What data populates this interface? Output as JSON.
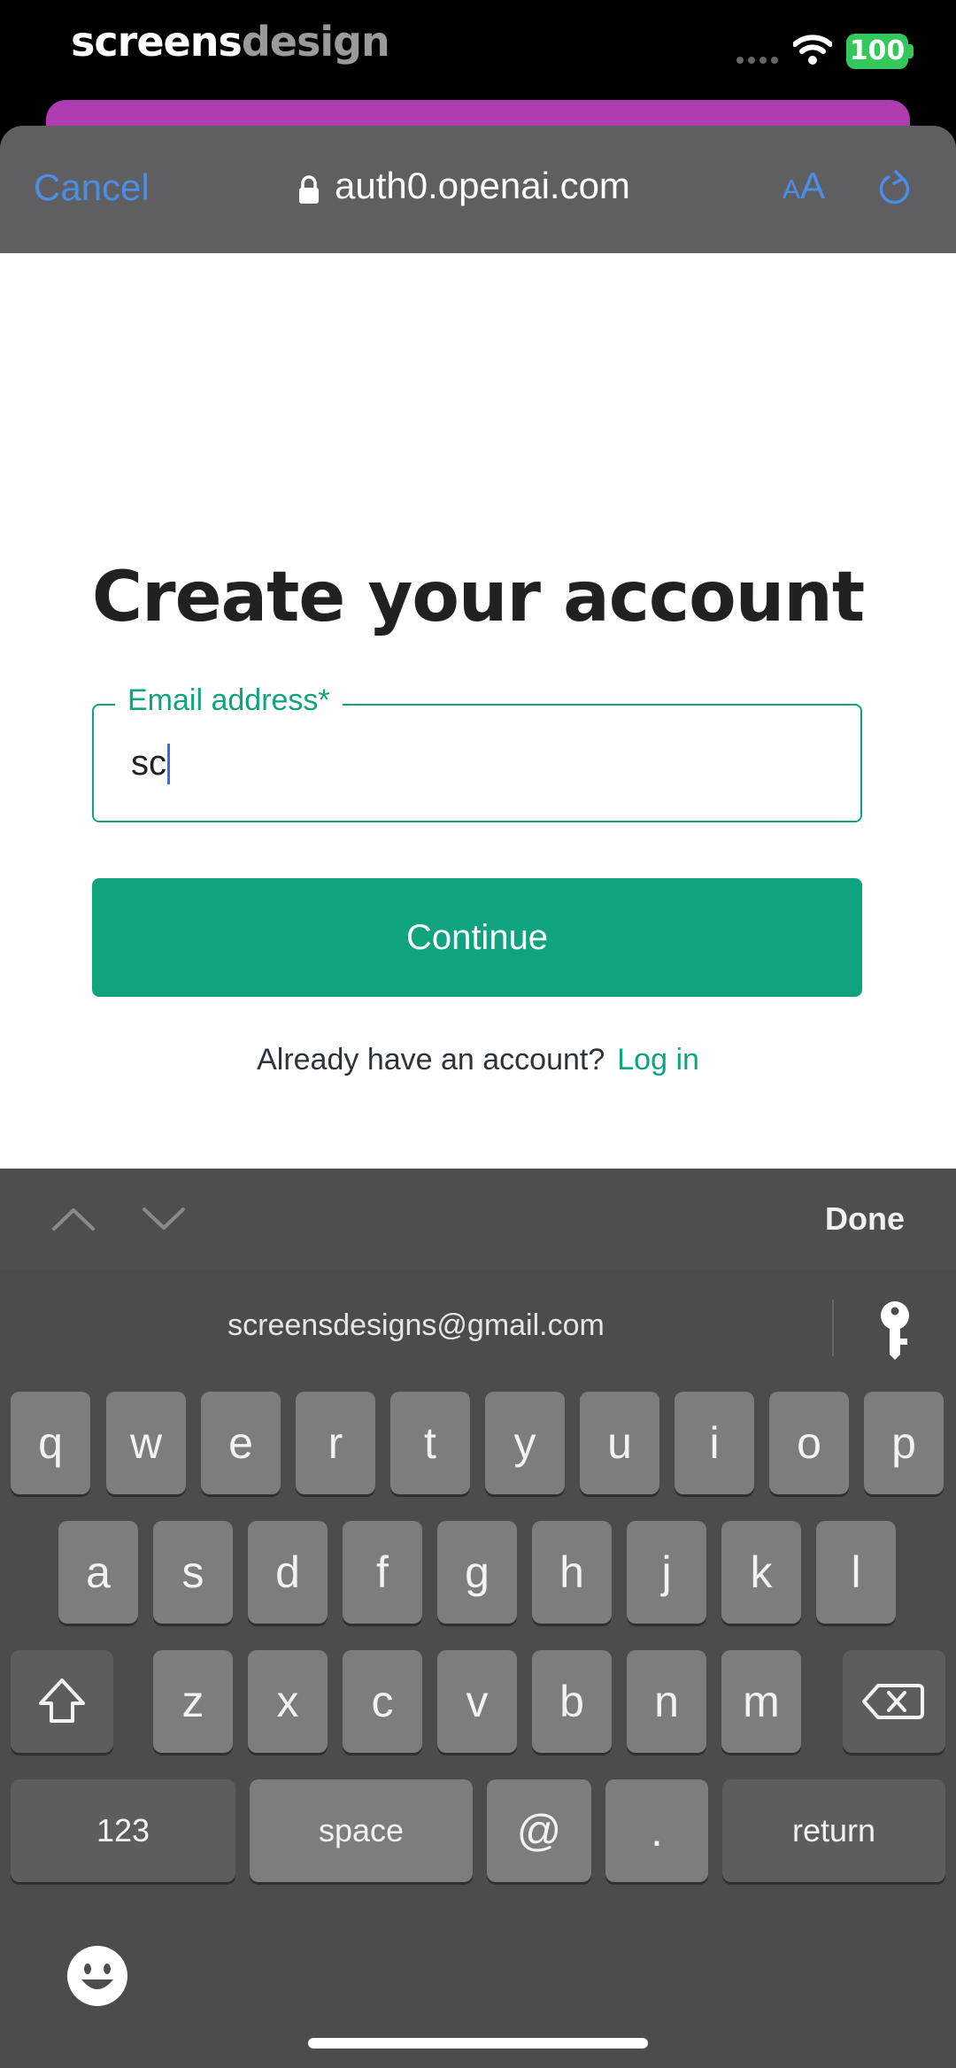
{
  "status_bar": {
    "watermark_part1": "screens",
    "watermark_part2": "design",
    "battery": "100"
  },
  "browser": {
    "cancel_label": "Cancel",
    "url": "auth0.openai.com",
    "aa_small": "A",
    "aa_big": "A"
  },
  "page": {
    "title": "Create your account",
    "email_label": "Email address*",
    "email_value": "sc",
    "continue_label": "Continue",
    "login_prompt": "Already have an account?",
    "login_link": "Log in"
  },
  "accessory": {
    "done_label": "Done"
  },
  "keyboard": {
    "suggestion": "screensdesigns@gmail.com",
    "row1": [
      "q",
      "w",
      "e",
      "r",
      "t",
      "y",
      "u",
      "i",
      "o",
      "p"
    ],
    "row2": [
      "a",
      "s",
      "d",
      "f",
      "g",
      "h",
      "j",
      "k",
      "l"
    ],
    "row3": [
      "z",
      "x",
      "c",
      "v",
      "b",
      "n",
      "m"
    ],
    "numbers_label": "123",
    "space_label": "space",
    "at_label": "@",
    "dot_label": ".",
    "return_label": "return"
  },
  "colors": {
    "accent_green": "#10a37f",
    "ios_blue": "#4a8ee8",
    "battery_green": "#34c759"
  }
}
